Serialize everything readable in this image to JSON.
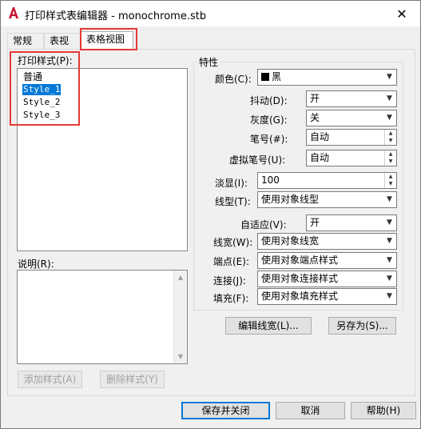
{
  "window": {
    "title": "打印样式表编辑器 - monochrome.stb",
    "close_glyph": "✕"
  },
  "tabs": [
    {
      "label": "常规"
    },
    {
      "label": "表视图"
    },
    {
      "label": "表格视图"
    }
  ],
  "styles": {
    "label": "打印样式(P):",
    "items": [
      "普通",
      "Style_1",
      "Style_2",
      "Style_3"
    ],
    "selected_index": 1
  },
  "description": {
    "label": "说明(R):",
    "value": ""
  },
  "buttons": {
    "add_style": "添加样式(A)",
    "delete_style": "删除样式(Y)",
    "edit_lineweights": "编辑线宽(L)...",
    "save_as": "另存为(S)...",
    "save_close": "保存并关闭",
    "cancel": "取消",
    "help": "帮助(H)"
  },
  "properties": {
    "group_label": "特性",
    "color": {
      "label": "颜色(C):",
      "value": "黑",
      "swatch": "#000000"
    },
    "dither": {
      "label": "抖动(D):",
      "value": "开"
    },
    "grayscale": {
      "label": "灰度(G):",
      "value": "关"
    },
    "pen": {
      "label": "笔号(#):",
      "value": "自动"
    },
    "virtual_pen": {
      "label": "虚拟笔号(U):",
      "value": "自动"
    },
    "screening": {
      "label": "淡显(I):",
      "value": "100"
    },
    "linetype": {
      "label": "线型(T):",
      "value": "使用对象线型"
    },
    "adaptive": {
      "label": "自适应(V):",
      "value": "开"
    },
    "lineweight": {
      "label": "线宽(W):",
      "value": "使用对象线宽"
    },
    "line_end": {
      "label": "端点(E):",
      "value": "使用对象端点样式"
    },
    "line_join": {
      "label": "连接(J):",
      "value": "使用对象连接样式"
    },
    "fill": {
      "label": "填充(F):",
      "value": "使用对象填充样式"
    }
  },
  "colors": {
    "accent": "#0078d7",
    "highlight": "#e53935",
    "app_icon": "#c8102e"
  }
}
